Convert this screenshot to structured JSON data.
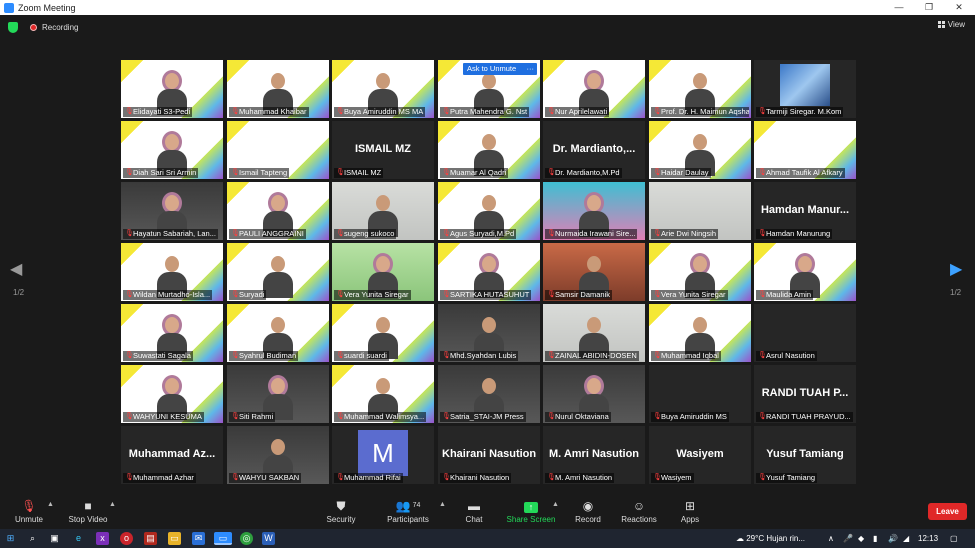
{
  "window": {
    "title": "Zoom Meeting",
    "minimize": "—",
    "maximize": "❐",
    "close": "✕"
  },
  "status": {
    "recording_label": "Recording",
    "view_label": "View"
  },
  "pager": {
    "left_indicator": "1/2",
    "right_indicator": "1/2"
  },
  "unmute_popup": {
    "label": "Ask to Unmute",
    "more": "···"
  },
  "participants": [
    {
      "name": "Elidayati S3-Pedi",
      "bg": "conf",
      "face": "hijab"
    },
    {
      "name": "Muhammad Khaibar",
      "bg": "conf",
      "face": "person"
    },
    {
      "name": "Buya Amiruddin MS MA",
      "bg": "conf",
      "face": "person"
    },
    {
      "name": "Putra Mahendra G. Nst",
      "bg": "conf",
      "face": "person"
    },
    {
      "name": "Nur Aprilelawati",
      "bg": "conf",
      "face": "hijab"
    },
    {
      "name": "Prof. Dr. H. Maimun Aqsha",
      "bg": "conf",
      "face": "person"
    },
    {
      "name": "Tarmiji Siregar. M.Kom",
      "bg": "blank",
      "face": "photo-small"
    },
    {
      "name": "Diah Sari Sri Armin",
      "bg": "conf",
      "face": "hijab"
    },
    {
      "name": "Ismail Tapteng",
      "bg": "conf",
      "face": "none"
    },
    {
      "name": "ISMAIL MZ",
      "bg": "blank",
      "face": "text",
      "big": "ISMAIL MZ"
    },
    {
      "name": "Muamar Al Qadri",
      "bg": "conf",
      "face": "person"
    },
    {
      "name": "Dr. Mardianto,M.Pd",
      "bg": "blank",
      "face": "text",
      "big": "Dr. Mardianto,..."
    },
    {
      "name": "Haidar Daulay",
      "bg": "conf",
      "face": "person"
    },
    {
      "name": "Ahmad Taufik Al Afkary",
      "bg": "conf",
      "face": "none"
    },
    {
      "name": "Hayatun Sabariah, Lan...",
      "bg": "photo",
      "face": "hijab"
    },
    {
      "name": "PAULI ANGGRAINI",
      "bg": "conf",
      "face": "hijab"
    },
    {
      "name": "sugeng sukoco",
      "bg": "wall",
      "face": "person"
    },
    {
      "name": "Agus Suryadi,M.Pd",
      "bg": "conf",
      "face": "person"
    },
    {
      "name": "Nurmaida Irawani Sire...",
      "bg": "pink",
      "face": "hijab"
    },
    {
      "name": "Arie Dwi Ningsih",
      "bg": "wall",
      "face": "none"
    },
    {
      "name": "Hamdan Manurung",
      "bg": "blank",
      "face": "text",
      "big": "Hamdan Manur..."
    },
    {
      "name": "Wildan Murtadho-Isla...",
      "bg": "conf",
      "face": "person"
    },
    {
      "name": "Suryadi",
      "bg": "conf",
      "face": "person"
    },
    {
      "name": "Vera Yunita Siregar",
      "bg": "green",
      "face": "hijab"
    },
    {
      "name": "SARTIKA HUTASUHUT",
      "bg": "conf",
      "face": "hijab"
    },
    {
      "name": "Samsir Damanik",
      "bg": "warm",
      "face": "person"
    },
    {
      "name": "Vera Yunita Siregar",
      "bg": "conf",
      "face": "hijab"
    },
    {
      "name": "Maulida Amin",
      "bg": "conf",
      "face": "hijab"
    },
    {
      "name": "Suwastati Sagala",
      "bg": "conf",
      "face": "hijab"
    },
    {
      "name": "Syahrul Budiman",
      "bg": "conf",
      "face": "person"
    },
    {
      "name": "suardi suardi",
      "bg": "conf",
      "face": "person"
    },
    {
      "name": "Mhd.Syahdan Lubis",
      "bg": "photo",
      "face": "person"
    },
    {
      "name": "ZAINAL ABIDIN-DOSEN",
      "bg": "wall",
      "face": "person"
    },
    {
      "name": "Muhammad Iqbal",
      "bg": "conf",
      "face": "person"
    },
    {
      "name": "Asrul Nasution",
      "bg": "blank",
      "face": "none"
    },
    {
      "name": "WAHYUNI KESUMA",
      "bg": "conf",
      "face": "hijab"
    },
    {
      "name": "Siti Rahmi",
      "bg": "photo",
      "face": "hijab"
    },
    {
      "name": "Muhammad Walimsya...",
      "bg": "conf",
      "face": "person"
    },
    {
      "name": "Satria_STAI-JM Press",
      "bg": "photo",
      "face": "person"
    },
    {
      "name": "Nurul Oktaviana",
      "bg": "photo",
      "face": "hijab"
    },
    {
      "name": "Buya Amiruddin MS",
      "bg": "blank",
      "face": "none"
    },
    {
      "name": "RANDI TUAH PRAYUD...",
      "bg": "blank",
      "face": "text",
      "big": "RANDI TUAH P..."
    },
    {
      "name": "Muhammad Azhar",
      "bg": "blank",
      "face": "text",
      "big": "Muhammad Az..."
    },
    {
      "name": "WAHYU SAKBAN",
      "bg": "photo",
      "face": "person"
    },
    {
      "name": "Muhammad Rifai",
      "bg": "blank",
      "face": "avatar",
      "big": "M"
    },
    {
      "name": "Khairani Nasution",
      "bg": "blank",
      "face": "text",
      "big": "Khairani Nasution"
    },
    {
      "name": "M. Amri Nasution",
      "bg": "blank",
      "face": "text",
      "big": "M. Amri Nasution"
    },
    {
      "name": "Wasiyem",
      "bg": "blank",
      "face": "text",
      "big": "Wasiyem"
    },
    {
      "name": "Yusuf Tamiang",
      "bg": "blank",
      "face": "text",
      "big": "Yusuf Tamiang"
    }
  ],
  "toolbar": {
    "unmute": "Unmute",
    "stop_video": "Stop Video",
    "security": "Security",
    "participants": "Participants",
    "participant_count": "74",
    "chat": "Chat",
    "share_screen": "Share Screen",
    "record": "Record",
    "reactions": "Reactions",
    "apps": "Apps",
    "leave": "Leave"
  },
  "taskbar": {
    "weather": "29°C  Hujan rin...",
    "time": "12:13"
  },
  "colors": {
    "accent_blue": "#2d8cff",
    "share_green": "#23d959",
    "leave_red": "#e02828"
  }
}
